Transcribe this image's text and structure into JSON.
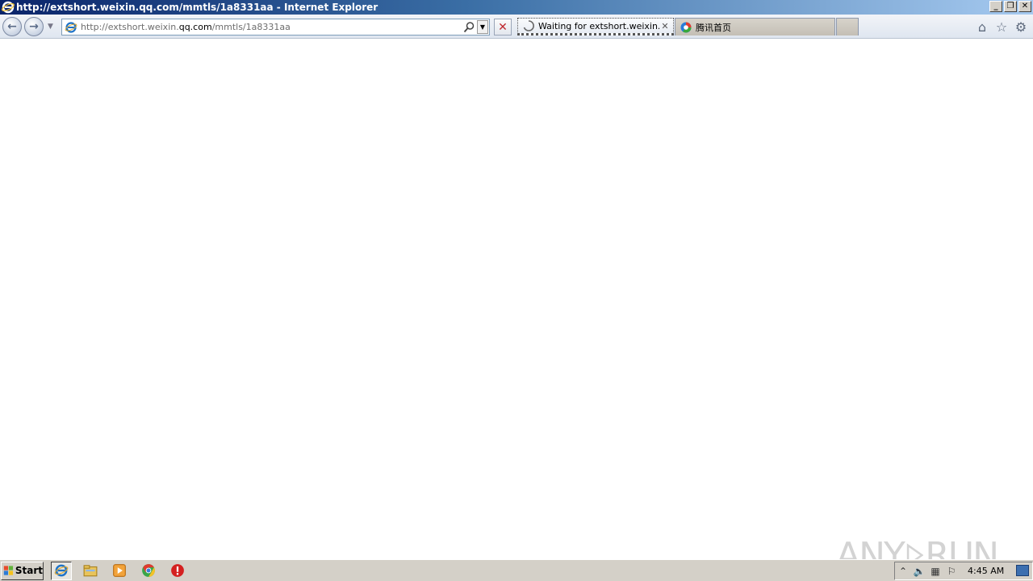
{
  "window": {
    "title": "http://extshort.weixin.qq.com/mmtls/1a8331aa - Internet Explorer",
    "controls": {
      "minimize": "_",
      "restore": "❐",
      "close": "✕"
    }
  },
  "navbar": {
    "back_glyph": "←",
    "forward_glyph": "→",
    "address": {
      "url_prefix": "http://extshort.weixin.",
      "url_domain": "qq.com",
      "url_suffix": "/mmtls/1a8331aa"
    },
    "stop_glyph": "✕",
    "tabs": [
      {
        "label": "Waiting for extshort.weixin....",
        "close": "✕"
      },
      {
        "label": "腾讯首页"
      }
    ]
  },
  "watermark": {
    "left": "ANY",
    "right": "RUN"
  },
  "taskbar": {
    "start_label": "Start",
    "clock": "4:45 AM"
  },
  "colors": {
    "title_gradient_start": "#0a246a",
    "title_gradient_end": "#a6caf0",
    "taskbar": "#d4d0c8",
    "stop_red": "#c0282d"
  }
}
